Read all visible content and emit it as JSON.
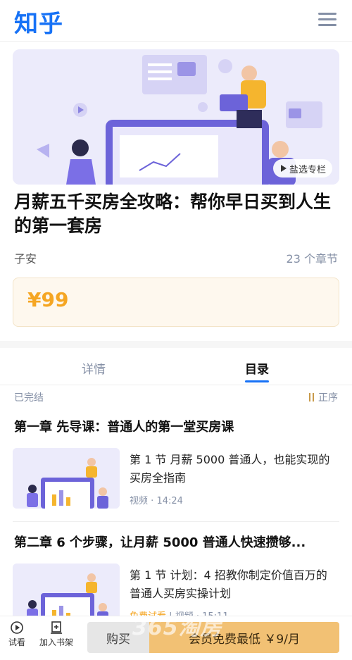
{
  "header": {
    "logo": "知乎"
  },
  "banner": {
    "badge": "盐选专栏"
  },
  "course": {
    "title": "月薪五千买房全攻略：帮你早日买到人生的第一套房",
    "author": "子安",
    "chapter_count": "23 个章节",
    "price": "¥99"
  },
  "tabs": [
    {
      "label": "详情"
    },
    {
      "label": "目录"
    }
  ],
  "toc": {
    "status": "已完结",
    "sort_label": "正序",
    "chapters": [
      {
        "title": "第一章 先导课：普通人的第一堂买房课",
        "items": [
          {
            "title": "第 1 节 月薪 5000 普通人，也能实现的买房全指南",
            "type": "视频",
            "duration": "14:24",
            "free": ""
          }
        ]
      },
      {
        "title": "第二章 6 个步骤，让月薪 5000 普通人快速攒够...",
        "items": [
          {
            "title": "第 1 节 计划：4 招教你制定价值百万的普通人买房实操计划",
            "type": "视频",
            "duration": "15:11",
            "free": "免费试看"
          }
        ]
      }
    ]
  },
  "bottom_bar": {
    "trial_label": "试看",
    "shelf_label": "加入书架",
    "buy_label": "购买",
    "member_label": "会员免费最低 ￥9/月"
  },
  "watermark": "365淘房",
  "colors": {
    "brand": "#1772f6",
    "price": "#f5a623",
    "member_button": "#f2c174"
  }
}
